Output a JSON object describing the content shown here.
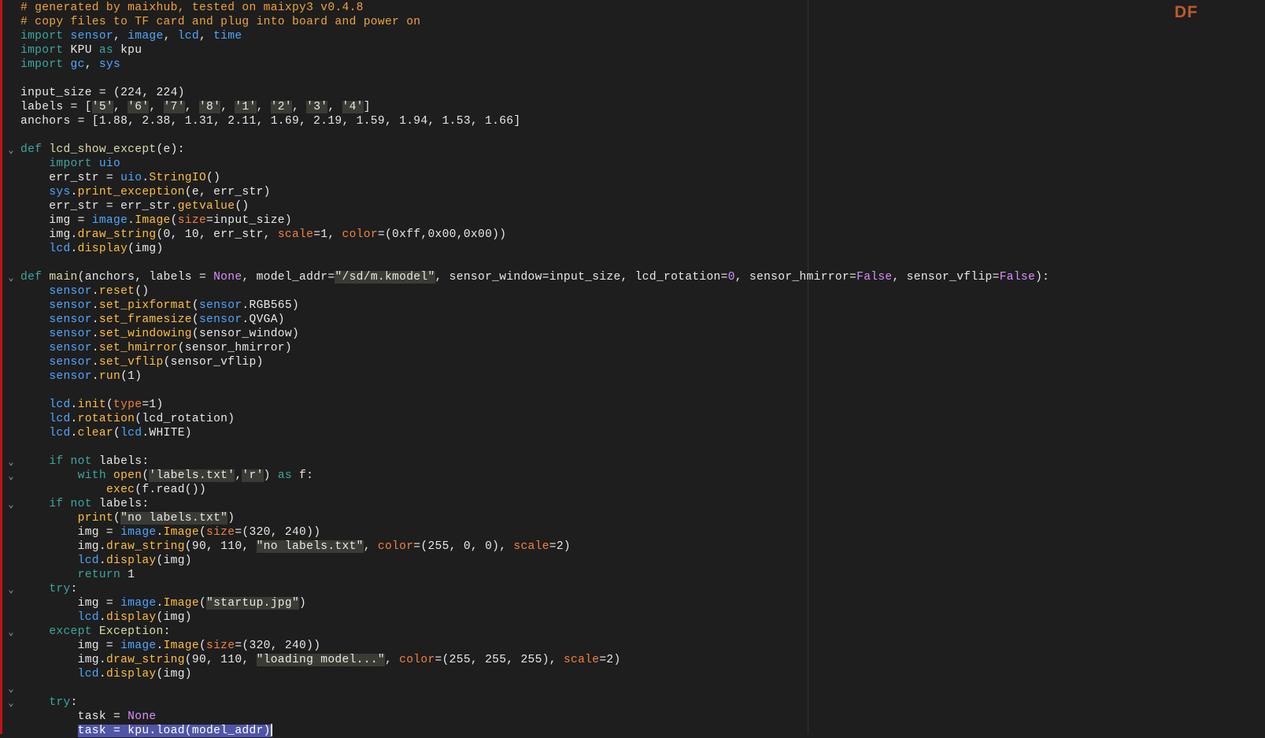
{
  "logo": "DF",
  "editor": {
    "fold_lines": [
      10,
      19,
      32,
      33,
      35,
      41,
      44,
      48,
      49
    ],
    "selected_line": 51,
    "lines": [
      [
        [
          "c",
          "# generated by maixhub, tested on maixpy3 v0.4.8"
        ]
      ],
      [
        [
          "c",
          "# copy files to TF card and plug into board and power on"
        ]
      ],
      [
        [
          "k",
          "import"
        ],
        [
          "p",
          " "
        ],
        [
          "m",
          "sensor"
        ],
        [
          "p",
          ", "
        ],
        [
          "m",
          "image"
        ],
        [
          "p",
          ", "
        ],
        [
          "m",
          "lcd"
        ],
        [
          "p",
          ", "
        ],
        [
          "m",
          "time"
        ]
      ],
      [
        [
          "k",
          "import"
        ],
        [
          "p",
          " KPU "
        ],
        [
          "k",
          "as"
        ],
        [
          "p",
          " kpu"
        ]
      ],
      [
        [
          "k",
          "import"
        ],
        [
          "p",
          " "
        ],
        [
          "m",
          "gc"
        ],
        [
          "p",
          ", "
        ],
        [
          "m",
          "sys"
        ]
      ],
      [],
      [
        [
          "p",
          "input_size = (224, 224)"
        ]
      ],
      [
        [
          "p",
          "labels = ["
        ],
        [
          "s",
          "'5'"
        ],
        [
          "p",
          ", "
        ],
        [
          "s",
          "'6'"
        ],
        [
          "p",
          ", "
        ],
        [
          "s",
          "'7'"
        ],
        [
          "p",
          ", "
        ],
        [
          "s",
          "'8'"
        ],
        [
          "p",
          ", "
        ],
        [
          "s",
          "'1'"
        ],
        [
          "p",
          ", "
        ],
        [
          "s",
          "'2'"
        ],
        [
          "p",
          ", "
        ],
        [
          "s",
          "'3'"
        ],
        [
          "p",
          ", "
        ],
        [
          "s",
          "'4'"
        ],
        [
          "p",
          "]"
        ]
      ],
      [
        [
          "p",
          "anchors = [1.88, 2.38, 1.31, 2.11, 1.69, 2.19, 1.59, 1.94, 1.53, 1.66]"
        ]
      ],
      [],
      [
        [
          "k",
          "def"
        ],
        [
          "p",
          " "
        ],
        [
          "n",
          "lcd_show_except"
        ],
        [
          "p",
          "(e):"
        ]
      ],
      [
        [
          "p",
          "    "
        ],
        [
          "k",
          "import"
        ],
        [
          "p",
          " "
        ],
        [
          "m",
          "uio"
        ]
      ],
      [
        [
          "p",
          "    err_str = "
        ],
        [
          "m",
          "uio"
        ],
        [
          "p",
          "."
        ],
        [
          "f",
          "StringIO"
        ],
        [
          "p",
          "()"
        ]
      ],
      [
        [
          "p",
          "    "
        ],
        [
          "m",
          "sys"
        ],
        [
          "p",
          "."
        ],
        [
          "f",
          "print_exception"
        ],
        [
          "p",
          "(e, err_str)"
        ]
      ],
      [
        [
          "p",
          "    err_str = err_str."
        ],
        [
          "f",
          "getvalue"
        ],
        [
          "p",
          "()"
        ]
      ],
      [
        [
          "p",
          "    img = "
        ],
        [
          "m",
          "image"
        ],
        [
          "p",
          "."
        ],
        [
          "f",
          "Image"
        ],
        [
          "p",
          "("
        ],
        [
          "a",
          "size"
        ],
        [
          "p",
          "=input_size)"
        ]
      ],
      [
        [
          "p",
          "    img."
        ],
        [
          "f",
          "draw_string"
        ],
        [
          "p",
          "(0, 10, err_str, "
        ],
        [
          "a",
          "scale"
        ],
        [
          "p",
          "=1, "
        ],
        [
          "a",
          "color"
        ],
        [
          "p",
          "=(0xff,0x00,0x00))"
        ]
      ],
      [
        [
          "p",
          "    "
        ],
        [
          "m",
          "lcd"
        ],
        [
          "p",
          "."
        ],
        [
          "f",
          "display"
        ],
        [
          "p",
          "(img)"
        ]
      ],
      [],
      [
        [
          "k",
          "def"
        ],
        [
          "p",
          " "
        ],
        [
          "n",
          "main"
        ],
        [
          "p",
          "(anchors, labels = "
        ],
        [
          "b",
          "None"
        ],
        [
          "p",
          ", model_addr="
        ],
        [
          "s",
          "\"/sd/m.kmodel\""
        ],
        [
          "p",
          ", sensor_window=input_size, lcd_rotation="
        ],
        [
          "b",
          "0"
        ],
        [
          "p",
          ", sensor_hmirror="
        ],
        [
          "b",
          "False"
        ],
        [
          "p",
          ", sensor_vflip="
        ],
        [
          "b",
          "False"
        ],
        [
          "p",
          "):"
        ]
      ],
      [
        [
          "p",
          "    "
        ],
        [
          "m",
          "sensor"
        ],
        [
          "p",
          "."
        ],
        [
          "f",
          "reset"
        ],
        [
          "p",
          "()"
        ]
      ],
      [
        [
          "p",
          "    "
        ],
        [
          "m",
          "sensor"
        ],
        [
          "p",
          "."
        ],
        [
          "f",
          "set_pixformat"
        ],
        [
          "p",
          "("
        ],
        [
          "m",
          "sensor"
        ],
        [
          "p",
          ".RGB565)"
        ]
      ],
      [
        [
          "p",
          "    "
        ],
        [
          "m",
          "sensor"
        ],
        [
          "p",
          "."
        ],
        [
          "f",
          "set_framesize"
        ],
        [
          "p",
          "("
        ],
        [
          "m",
          "sensor"
        ],
        [
          "p",
          ".QVGA)"
        ]
      ],
      [
        [
          "p",
          "    "
        ],
        [
          "m",
          "sensor"
        ],
        [
          "p",
          "."
        ],
        [
          "f",
          "set_windowing"
        ],
        [
          "p",
          "(sensor_window)"
        ]
      ],
      [
        [
          "p",
          "    "
        ],
        [
          "m",
          "sensor"
        ],
        [
          "p",
          "."
        ],
        [
          "f",
          "set_hmirror"
        ],
        [
          "p",
          "(sensor_hmirror)"
        ]
      ],
      [
        [
          "p",
          "    "
        ],
        [
          "m",
          "sensor"
        ],
        [
          "p",
          "."
        ],
        [
          "f",
          "set_vflip"
        ],
        [
          "p",
          "(sensor_vflip)"
        ]
      ],
      [
        [
          "p",
          "    "
        ],
        [
          "m",
          "sensor"
        ],
        [
          "p",
          "."
        ],
        [
          "f",
          "run"
        ],
        [
          "p",
          "(1)"
        ]
      ],
      [],
      [
        [
          "p",
          "    "
        ],
        [
          "m",
          "lcd"
        ],
        [
          "p",
          "."
        ],
        [
          "f",
          "init"
        ],
        [
          "p",
          "("
        ],
        [
          "a",
          "type"
        ],
        [
          "p",
          "=1)"
        ]
      ],
      [
        [
          "p",
          "    "
        ],
        [
          "m",
          "lcd"
        ],
        [
          "p",
          "."
        ],
        [
          "f",
          "rotation"
        ],
        [
          "p",
          "(lcd_rotation)"
        ]
      ],
      [
        [
          "p",
          "    "
        ],
        [
          "m",
          "lcd"
        ],
        [
          "p",
          "."
        ],
        [
          "f",
          "clear"
        ],
        [
          "p",
          "("
        ],
        [
          "m",
          "lcd"
        ],
        [
          "p",
          ".WHITE)"
        ]
      ],
      [],
      [
        [
          "p",
          "    "
        ],
        [
          "k",
          "if"
        ],
        [
          "p",
          " "
        ],
        [
          "k",
          "not"
        ],
        [
          "p",
          " labels:"
        ]
      ],
      [
        [
          "p",
          "        "
        ],
        [
          "k",
          "with"
        ],
        [
          "p",
          " "
        ],
        [
          "f",
          "open"
        ],
        [
          "p",
          "("
        ],
        [
          "s",
          "'labels.txt'"
        ],
        [
          "p",
          ","
        ],
        [
          "s",
          "'r'"
        ],
        [
          "p",
          ") "
        ],
        [
          "k",
          "as"
        ],
        [
          "p",
          " f:"
        ]
      ],
      [
        [
          "p",
          "            "
        ],
        [
          "f",
          "exec"
        ],
        [
          "p",
          "(f.read())"
        ]
      ],
      [
        [
          "p",
          "    "
        ],
        [
          "k",
          "if"
        ],
        [
          "p",
          " "
        ],
        [
          "k",
          "not"
        ],
        [
          "p",
          " labels:"
        ]
      ],
      [
        [
          "p",
          "        "
        ],
        [
          "f",
          "print"
        ],
        [
          "p",
          "("
        ],
        [
          "s",
          "\"no labels.txt\""
        ],
        [
          "p",
          ")"
        ]
      ],
      [
        [
          "p",
          "        img = "
        ],
        [
          "m",
          "image"
        ],
        [
          "p",
          "."
        ],
        [
          "f",
          "Image"
        ],
        [
          "p",
          "("
        ],
        [
          "a",
          "size"
        ],
        [
          "p",
          "=(320, 240))"
        ]
      ],
      [
        [
          "p",
          "        img."
        ],
        [
          "f",
          "draw_string"
        ],
        [
          "p",
          "(90, 110, "
        ],
        [
          "s",
          "\"no labels.txt\""
        ],
        [
          "p",
          ", "
        ],
        [
          "a",
          "color"
        ],
        [
          "p",
          "=(255, 0, 0), "
        ],
        [
          "a",
          "scale"
        ],
        [
          "p",
          "=2)"
        ]
      ],
      [
        [
          "p",
          "        "
        ],
        [
          "m",
          "lcd"
        ],
        [
          "p",
          "."
        ],
        [
          "f",
          "display"
        ],
        [
          "p",
          "(img)"
        ]
      ],
      [
        [
          "p",
          "        "
        ],
        [
          "k",
          "return"
        ],
        [
          "p",
          " 1"
        ]
      ],
      [
        [
          "p",
          "    "
        ],
        [
          "k",
          "try"
        ],
        [
          "p",
          ":"
        ]
      ],
      [
        [
          "p",
          "        img = "
        ],
        [
          "m",
          "image"
        ],
        [
          "p",
          "."
        ],
        [
          "f",
          "Image"
        ],
        [
          "p",
          "("
        ],
        [
          "s",
          "\"startup.jpg\""
        ],
        [
          "p",
          ")"
        ]
      ],
      [
        [
          "p",
          "        "
        ],
        [
          "m",
          "lcd"
        ],
        [
          "p",
          "."
        ],
        [
          "f",
          "display"
        ],
        [
          "p",
          "(img)"
        ]
      ],
      [
        [
          "p",
          "    "
        ],
        [
          "k",
          "except"
        ],
        [
          "p",
          " "
        ],
        [
          "n",
          "Exception"
        ],
        [
          "p",
          ":"
        ]
      ],
      [
        [
          "p",
          "        img = "
        ],
        [
          "m",
          "image"
        ],
        [
          "p",
          "."
        ],
        [
          "f",
          "Image"
        ],
        [
          "p",
          "("
        ],
        [
          "a",
          "size"
        ],
        [
          "p",
          "=(320, 240))"
        ]
      ],
      [
        [
          "p",
          "        img."
        ],
        [
          "f",
          "draw_string"
        ],
        [
          "p",
          "(90, 110, "
        ],
        [
          "s",
          "\"loading model...\""
        ],
        [
          "p",
          ", "
        ],
        [
          "a",
          "color"
        ],
        [
          "p",
          "=(255, 255, 255), "
        ],
        [
          "a",
          "scale"
        ],
        [
          "p",
          "=2)"
        ]
      ],
      [
        [
          "p",
          "        "
        ],
        [
          "m",
          "lcd"
        ],
        [
          "p",
          "."
        ],
        [
          "f",
          "display"
        ],
        [
          "p",
          "(img)"
        ]
      ],
      [],
      [
        [
          "p",
          "    "
        ],
        [
          "k",
          "try"
        ],
        [
          "p",
          ":"
        ]
      ],
      [
        [
          "p",
          "        task = "
        ],
        [
          "b",
          "None"
        ]
      ],
      [
        [
          "p",
          "        "
        ],
        [
          "v",
          "task = kpu.load(model_addr)"
        ]
      ]
    ]
  },
  "colors": {
    "background": "#1e1e1e",
    "comment": "#f0a339",
    "keyword": "#3aa7a0",
    "module": "#4ea6ff",
    "function": "#ffbe3d",
    "argument": "#f2813c",
    "builtin_constant": "#d98eff",
    "selection": "#5055a8",
    "left_marker": "#c1121c"
  }
}
